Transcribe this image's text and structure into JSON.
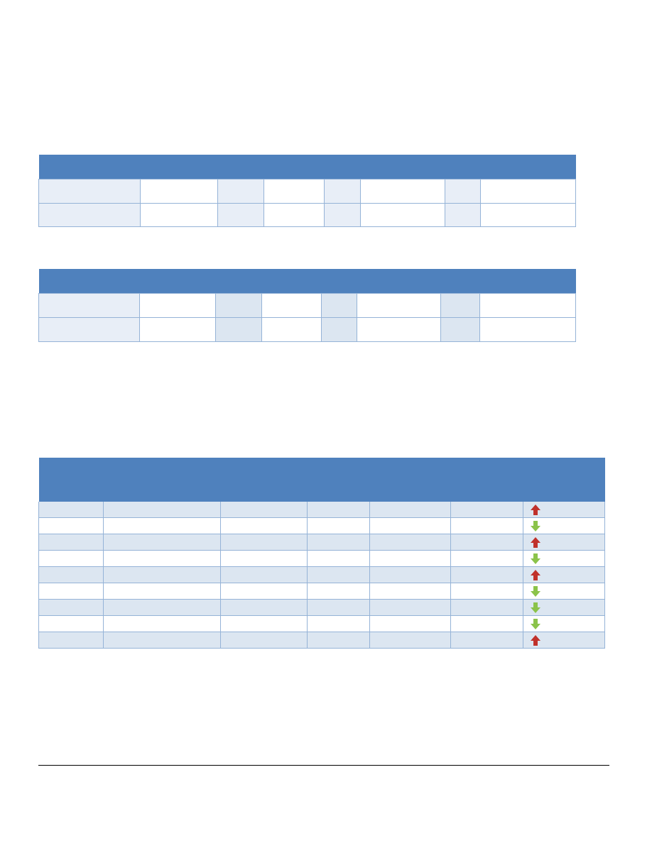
{
  "colors": {
    "header": "#4f81bd",
    "label_fill": "#dce6f1",
    "border": "#95b3d7",
    "arrow_up": "#c0312b",
    "arrow_down": "#8bc34a"
  },
  "icons": {
    "up": "arrow-up-icon",
    "down": "arrow-down-icon"
  },
  "trend_rows": [
    {
      "trend": "up"
    },
    {
      "trend": "down"
    },
    {
      "trend": "up"
    },
    {
      "trend": "down"
    },
    {
      "trend": "up"
    },
    {
      "trend": "down"
    },
    {
      "trend": "down"
    },
    {
      "trend": "down"
    },
    {
      "trend": "up"
    }
  ]
}
